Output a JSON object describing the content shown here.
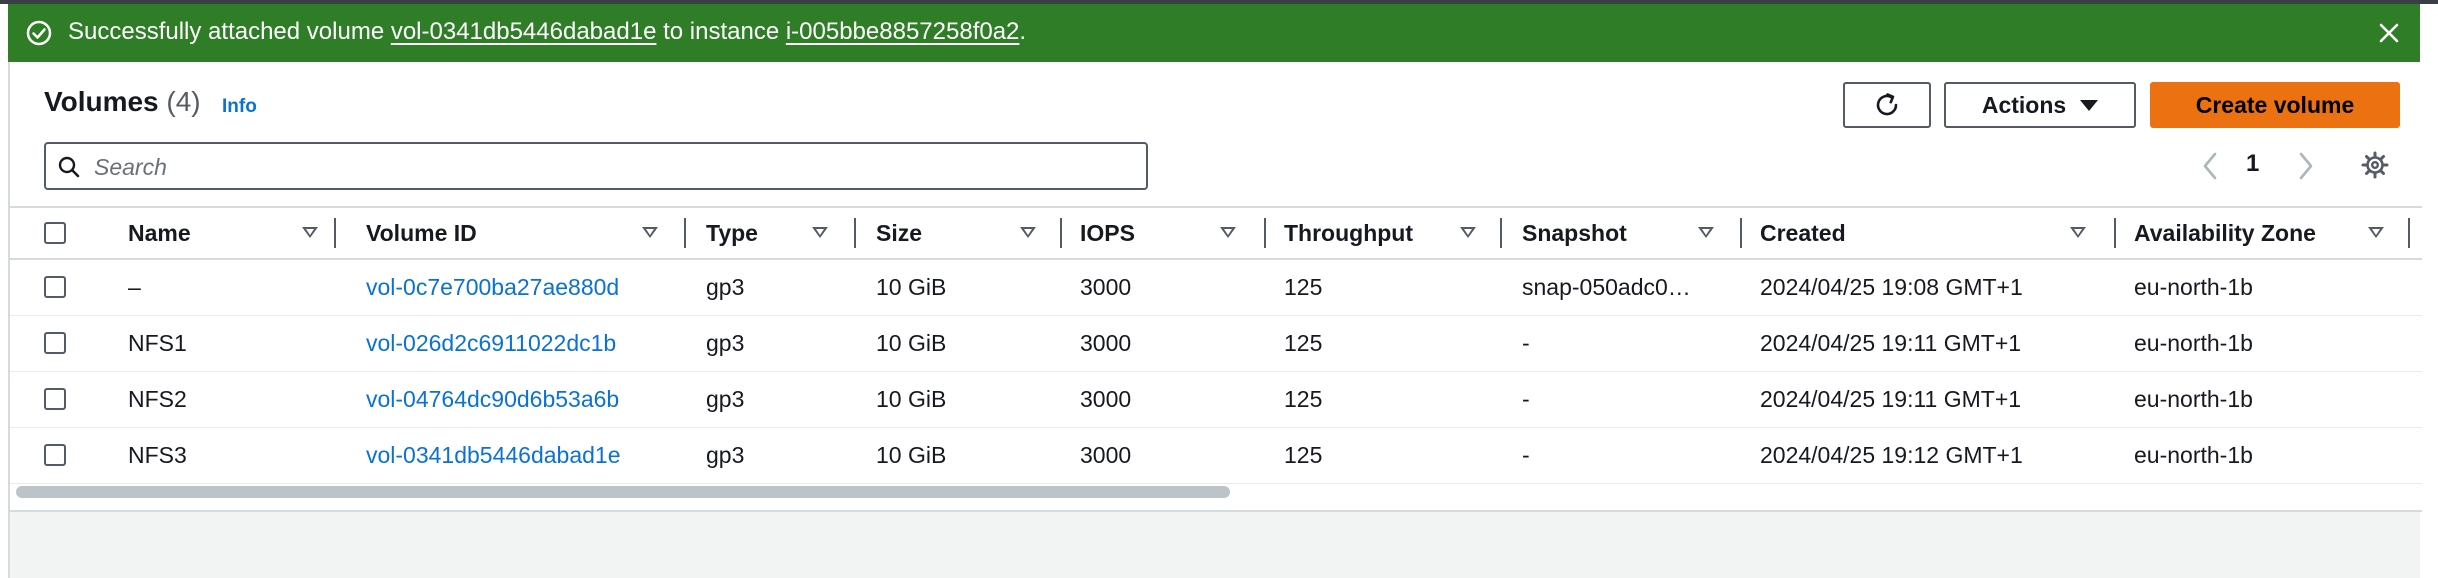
{
  "flash": {
    "prefix": "Successfully attached volume ",
    "volume_link": "vol-0341db5446dabad1e",
    "middle": " to instance ",
    "instance_link": "i-005bbe8857258f0a2",
    "suffix": "."
  },
  "header": {
    "title": "Volumes",
    "count": "(4)",
    "info": "Info",
    "actions_label": "Actions",
    "create_label": "Create volume"
  },
  "search": {
    "placeholder": "Search",
    "value": ""
  },
  "pagination": {
    "page": "1"
  },
  "table": {
    "columns": [
      "Name",
      "Volume ID",
      "Type",
      "Size",
      "IOPS",
      "Throughput",
      "Snapshot",
      "Created",
      "Availability Zone"
    ],
    "rows": [
      [
        "–",
        "vol-0c7e700ba27ae880d",
        "gp3",
        "10 GiB",
        "3000",
        "125",
        "snap-050adc0…",
        "2024/04/25 19:08 GMT+1",
        "eu-north-1b"
      ],
      [
        "NFS1",
        "vol-026d2c6911022dc1b",
        "gp3",
        "10 GiB",
        "3000",
        "125",
        "-",
        "2024/04/25 19:11 GMT+1",
        "eu-north-1b"
      ],
      [
        "NFS2",
        "vol-04764dc90d6b53a6b",
        "gp3",
        "10 GiB",
        "3000",
        "125",
        "-",
        "2024/04/25 19:11 GMT+1",
        "eu-north-1b"
      ],
      [
        "NFS3",
        "vol-0341db5446dabad1e",
        "gp3",
        "10 GiB",
        "3000",
        "125",
        "-",
        "2024/04/25 19:12 GMT+1",
        "eu-north-1b"
      ]
    ]
  },
  "colors": {
    "success_banner": "#2f7d27",
    "primary_button": "#ec7211",
    "link": "#0972d3"
  },
  "icons": [
    "check-circle-icon",
    "close-icon",
    "refresh-icon",
    "caret-down-icon",
    "search-icon",
    "chevron-left-icon",
    "chevron-right-icon",
    "settings-icon",
    "sort-icon"
  ]
}
